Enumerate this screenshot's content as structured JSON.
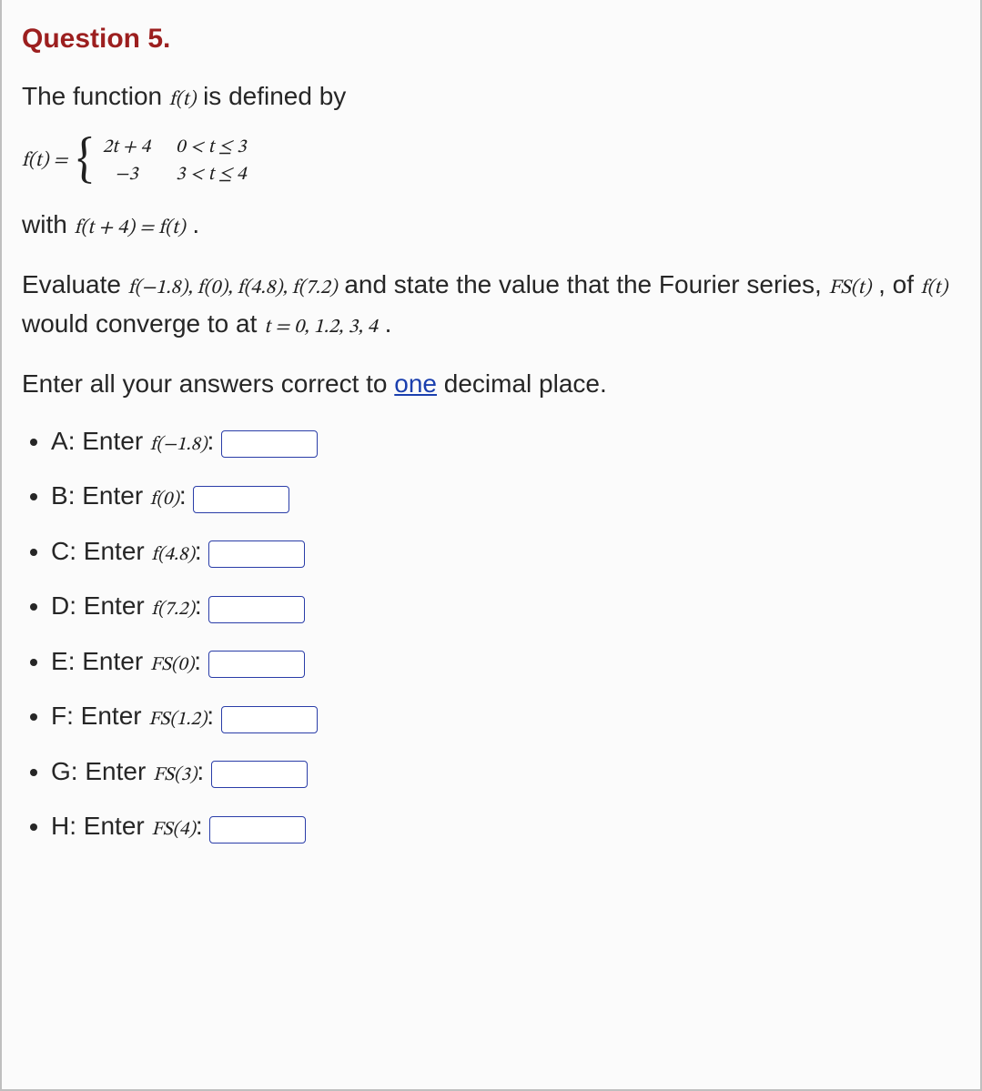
{
  "title": "Question 5.",
  "intro": {
    "pre": "The function ",
    "fn": "f(t)",
    "post": " is defined by"
  },
  "piecewise": {
    "lhs": "f(t) =",
    "rows": [
      {
        "expr": "2t + 4",
        "cond": "0 < t ≤ 3"
      },
      {
        "expr": "−3",
        "cond": "3 < t ≤ 4"
      }
    ]
  },
  "periodic": {
    "pre": "with ",
    "eqn": "f(t + 4) = f(t)",
    "post": " ."
  },
  "eval": {
    "pre": "Evaluate ",
    "list": "f(−1.8), f(0), f(4.8), f(7.2)",
    "mid1": " and state the value that the Fourier series, ",
    "fs": "FS(t)",
    "mid2": ", of ",
    "fn": "f(t)",
    "mid3": " would converge to at ",
    "tvals": "t = 0, 1.2, 3, 4",
    "end": "."
  },
  "instruction": {
    "pre": "Enter all your answers correct to ",
    "one": "one",
    "post": " decimal place."
  },
  "items": [
    {
      "letter": "A",
      "verb": "Enter",
      "expr": "f(−1.8)"
    },
    {
      "letter": "B",
      "verb": "Enter",
      "expr": "f(0)"
    },
    {
      "letter": "C",
      "verb": "Enter",
      "expr": "f(4.8)"
    },
    {
      "letter": "D",
      "verb": "Enter",
      "expr": "f(7.2)"
    },
    {
      "letter": "E",
      "verb": "Enter",
      "expr": "FS(0)"
    },
    {
      "letter": "F",
      "verb": "Enter",
      "expr": "FS(1.2)"
    },
    {
      "letter": "G",
      "verb": "Enter",
      "expr": "FS(3)"
    },
    {
      "letter": "H",
      "verb": "Enter",
      "expr": "FS(4)"
    }
  ]
}
